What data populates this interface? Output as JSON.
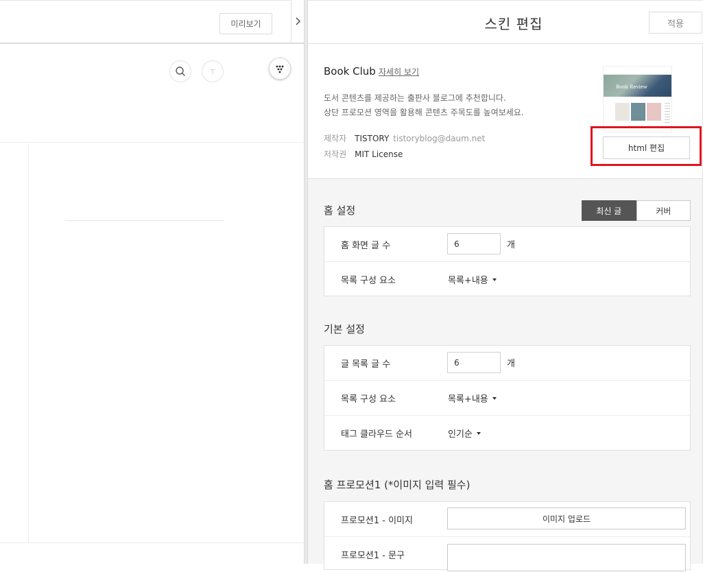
{
  "left": {
    "preview_label": "미리보기"
  },
  "right": {
    "title": "스킨 편집",
    "apply_label": "적용"
  },
  "skin": {
    "name": "Book Club",
    "detail_link": "자세히 보기",
    "desc_line1": "도서 콘텐츠를 제공하는 출판사 블로그에 추천합니다.",
    "desc_line2": "상단 프로모션 영역을 활용해 콘텐츠 주목도를 높여보세요.",
    "maker_label": "제작자",
    "maker_name": "TISTORY",
    "maker_email": "tistoryblog@daum.net",
    "license_label": "저작권",
    "license_value": "MIT License",
    "thumb_text": "Book Review",
    "html_edit_label": "html 편집"
  },
  "home": {
    "title": "홈 설정",
    "toggle_recent": "최신 글",
    "toggle_cover": "커버",
    "posts_label": "홈 화면 글 수",
    "posts_value": "6",
    "unit": "개",
    "list_label": "목록 구성 요소",
    "list_value": "목록+내용"
  },
  "basic": {
    "title": "기본 설정",
    "posts_label": "글 목록 글 수",
    "posts_value": "6",
    "unit": "개",
    "list_label": "목록 구성 요소",
    "list_value": "목록+내용",
    "tag_label": "태그 클라우드 순서",
    "tag_value": "인기순"
  },
  "promo": {
    "title": "홈 프로모션1 (*이미지 입력 필수)",
    "image_label": "프로모션1 - 이미지",
    "upload_label": "이미지 업로드",
    "text_label": "프로모션1 - 문구"
  },
  "colors": {
    "highlight": "#e0141e",
    "active_toggle": "#555555"
  }
}
